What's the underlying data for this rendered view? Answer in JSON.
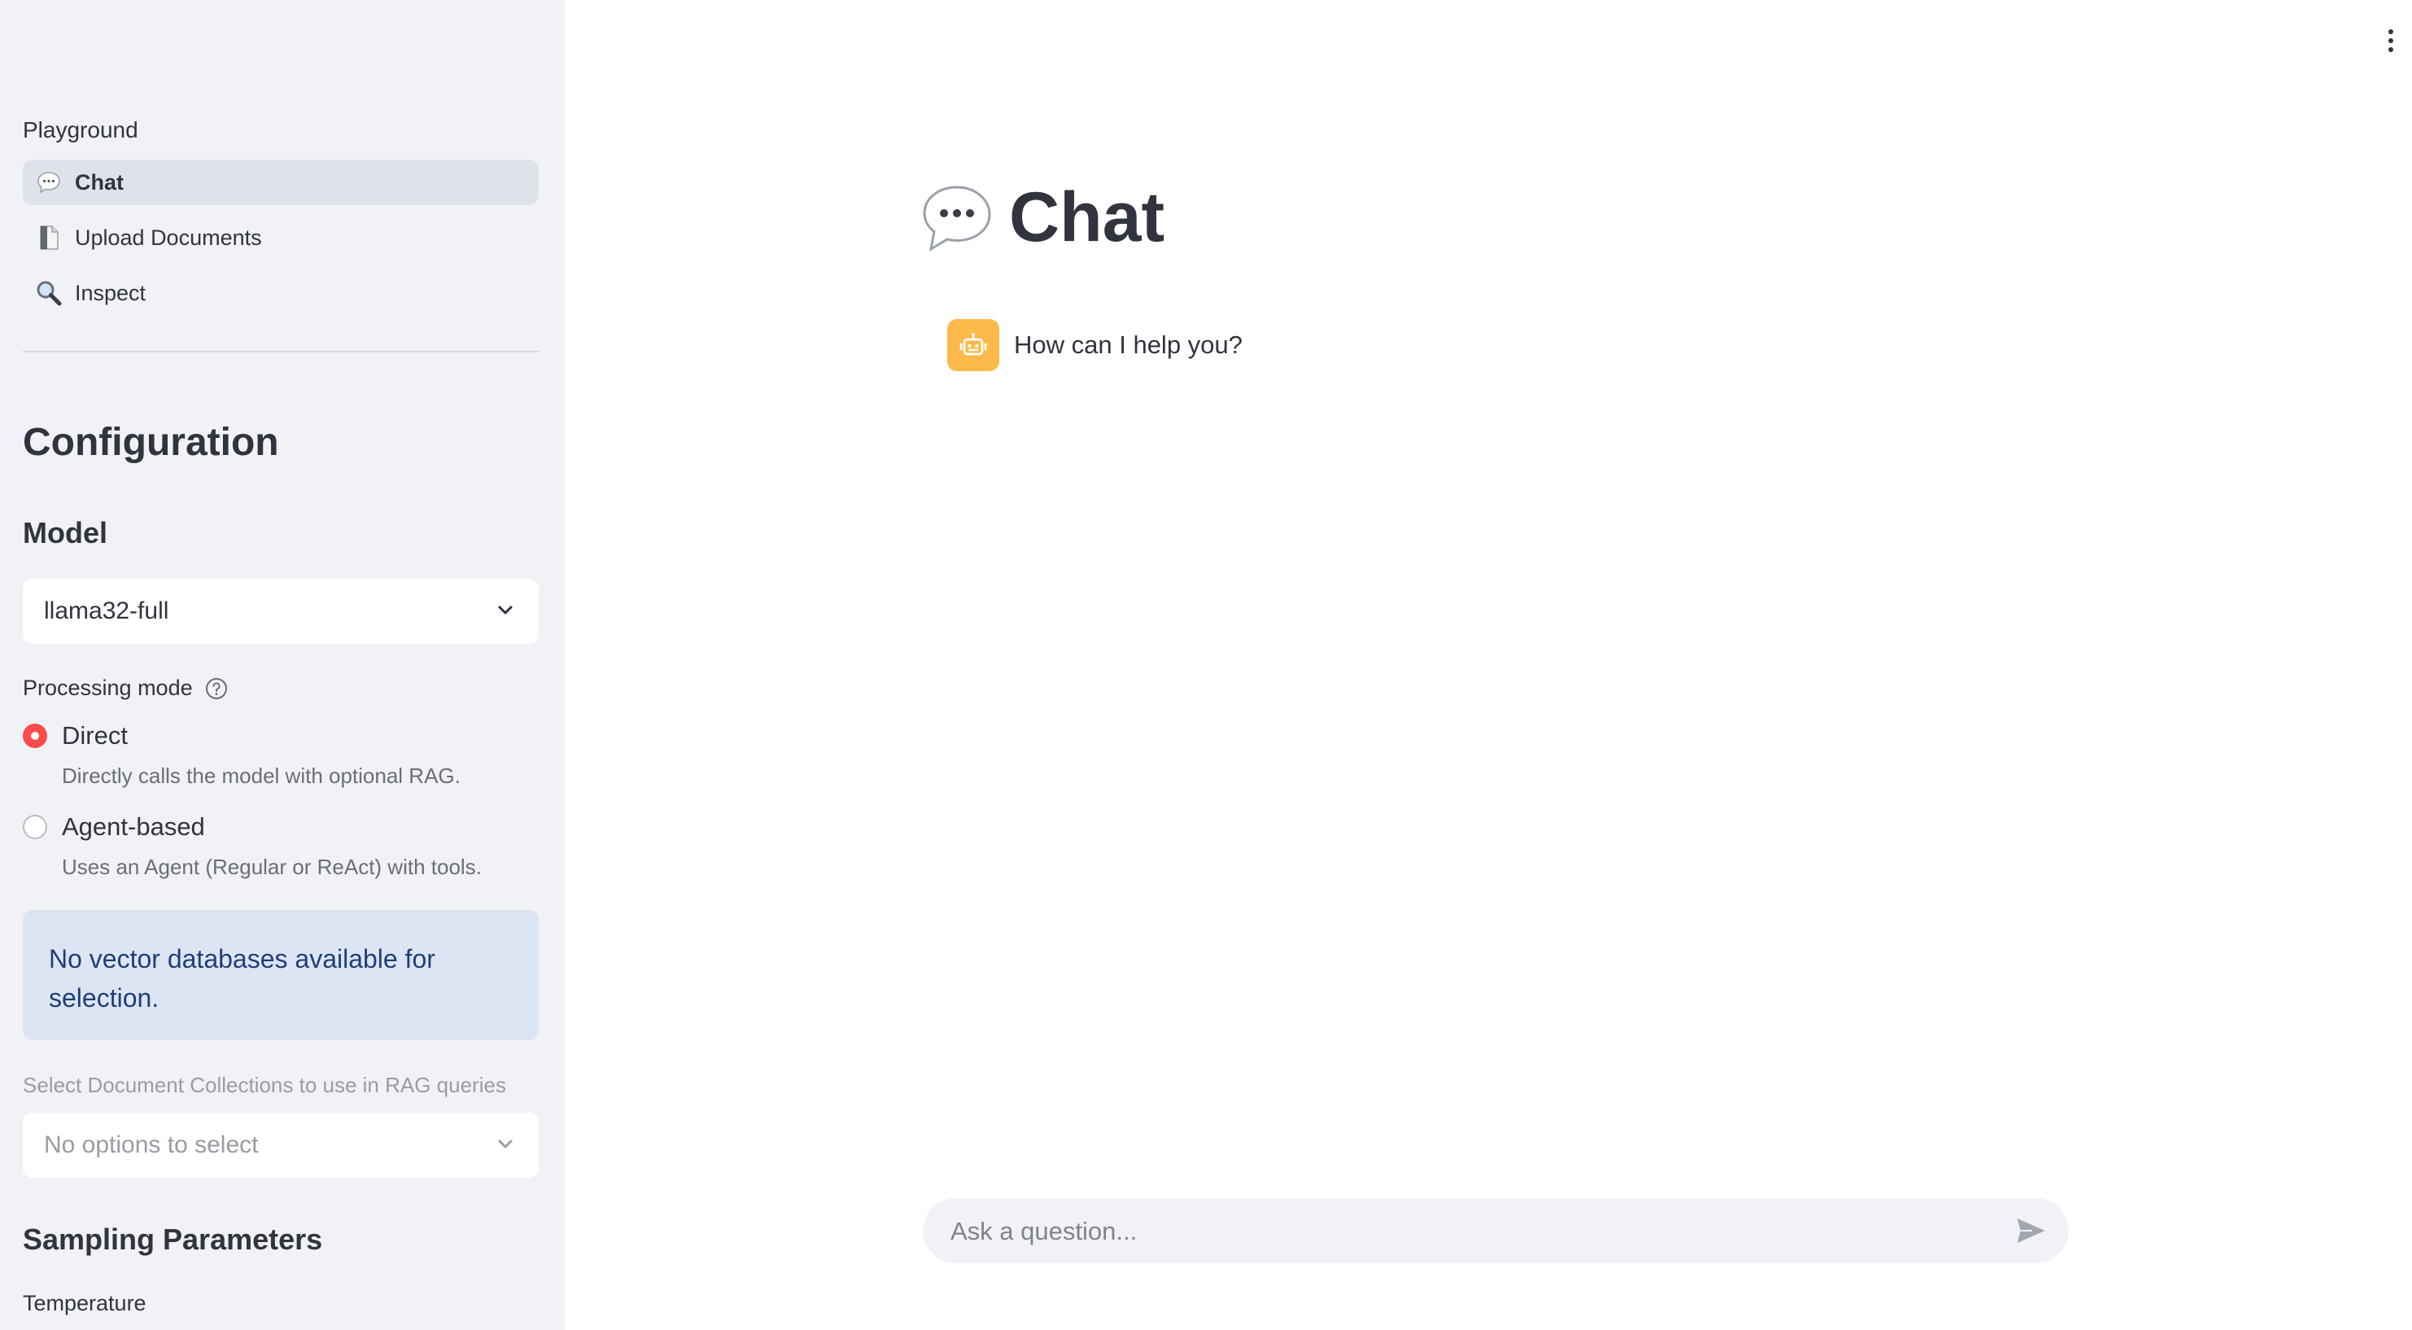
{
  "sidebar": {
    "nav_heading": "Playground",
    "nav_items": [
      {
        "label": "Chat",
        "icon": "speech-bubble-icon",
        "active": true
      },
      {
        "label": "Upload Documents",
        "icon": "document-icon",
        "active": false
      },
      {
        "label": "Inspect",
        "icon": "magnifier-icon",
        "active": false
      }
    ],
    "config_title": "Configuration",
    "model_label": "Model",
    "model_value": "llama32-full",
    "processing_mode_label": "Processing mode",
    "modes": [
      {
        "label": "Direct",
        "description": "Directly calls the model with optional RAG.",
        "selected": true
      },
      {
        "label": "Agent-based",
        "description": "Uses an Agent (Regular or ReAct) with tools.",
        "selected": false
      }
    ],
    "info_message": "No vector databases available for selection.",
    "collections_label": "Select Document Collections to use in RAG queries",
    "collections_placeholder": "No options to select",
    "sampling_title": "Sampling Parameters",
    "temperature_label": "Temperature"
  },
  "main": {
    "title": "Chat",
    "messages": [
      {
        "role": "assistant",
        "avatar_icon": "robot-icon",
        "text": "How can I help you?"
      }
    ],
    "input_placeholder": "Ask a question...",
    "input_value": ""
  },
  "colors": {
    "sidebar_bg": "#f0f2f6",
    "accent": "#ff4b4b",
    "info_bg": "#dde5f4",
    "info_text": "#1e3f7a",
    "avatar_bg": "#fdb94a"
  }
}
